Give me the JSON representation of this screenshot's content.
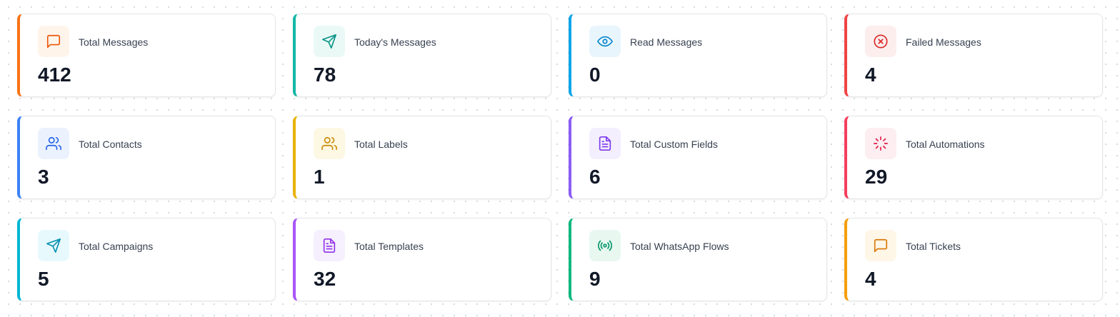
{
  "cards": [
    {
      "id": "total-messages",
      "label": "Total Messages",
      "value": "412",
      "icon": "message-square-icon",
      "accent": "#f97316",
      "icon_color": "#ea580c",
      "icon_bg": "#fff4ea"
    },
    {
      "id": "todays-messages",
      "label": "Today's Messages",
      "value": "78",
      "icon": "send-icon",
      "accent": "#14b8a6",
      "icon_color": "#0d9488",
      "icon_bg": "#eaf9f6"
    },
    {
      "id": "read-messages",
      "label": "Read Messages",
      "value": "0",
      "icon": "eye-icon",
      "accent": "#0ea5e9",
      "icon_color": "#0284c7",
      "icon_bg": "#e8f5fd"
    },
    {
      "id": "failed-messages",
      "label": "Failed Messages",
      "value": "4",
      "icon": "x-circle-icon",
      "accent": "#ef4444",
      "icon_color": "#dc2626",
      "icon_bg": "#fdeeee"
    },
    {
      "id": "total-contacts",
      "label": "Total Contacts",
      "value": "3",
      "icon": "users-icon",
      "accent": "#3b82f6",
      "icon_color": "#2563eb",
      "icon_bg": "#ebf2fe"
    },
    {
      "id": "total-labels",
      "label": "Total Labels",
      "value": "1",
      "icon": "users-icon",
      "accent": "#eab308",
      "icon_color": "#ca8a04",
      "icon_bg": "#fdf8e4"
    },
    {
      "id": "total-custom-fields",
      "label": "Total Custom Fields",
      "value": "6",
      "icon": "file-text-icon",
      "accent": "#8b5cf6",
      "icon_color": "#7c3aed",
      "icon_bg": "#f3effe"
    },
    {
      "id": "total-automations",
      "label": "Total Automations",
      "value": "29",
      "icon": "loader-icon",
      "accent": "#f43f5e",
      "icon_color": "#e11d48",
      "icon_bg": "#fdeef1"
    },
    {
      "id": "total-campaigns",
      "label": "Total Campaigns",
      "value": "5",
      "icon": "send-icon",
      "accent": "#06b6d4",
      "icon_color": "#0891b2",
      "icon_bg": "#e7f9fc"
    },
    {
      "id": "total-templates",
      "label": "Total Templates",
      "value": "32",
      "icon": "file-text-icon",
      "accent": "#a855f7",
      "icon_color": "#9333ea",
      "icon_bg": "#f5effe"
    },
    {
      "id": "total-whatsapp-flows",
      "label": "Total WhatsApp Flows",
      "value": "9",
      "icon": "radio-icon",
      "accent": "#10b981",
      "icon_color": "#059669",
      "icon_bg": "#e8f8f1"
    },
    {
      "id": "total-tickets",
      "label": "Total Tickets",
      "value": "4",
      "icon": "message-square-icon",
      "accent": "#f59e0b",
      "icon_color": "#d97706",
      "icon_bg": "#fef6e7"
    }
  ]
}
